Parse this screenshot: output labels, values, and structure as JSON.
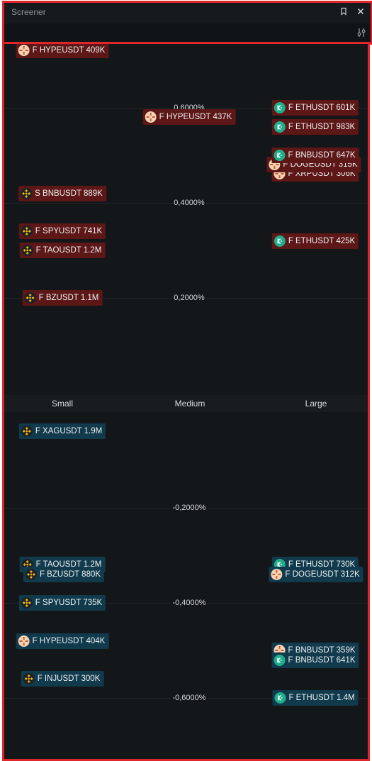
{
  "window": {
    "title": "Screener"
  },
  "axis": {
    "upper_labels": [
      "0,6000%",
      "0,4000%",
      "0,2000%"
    ],
    "lower_labels": [
      "-0,2000%",
      "-0,4000%",
      "-0,6000%"
    ]
  },
  "categories": [
    "Small",
    "Medium",
    "Large"
  ],
  "colors": {
    "positive": "#5c1716",
    "negative": "#113a4c",
    "frame": "#e0262a"
  },
  "tickers_positive": [
    {
      "label": "F HYPEUSDT 409K",
      "icon": "hyperliquid-icon"
    },
    {
      "label": "F HYPEUSDT 437K",
      "icon": "hyperliquid-icon"
    },
    {
      "label": "F ETHUSDT 601K",
      "icon": "kucoin-icon"
    },
    {
      "label": "F ETHUSDT 983K",
      "icon": "kucoin-icon"
    },
    {
      "label": "F BNBUSDT 647K",
      "icon": "kucoin-icon"
    },
    {
      "label": "F XRPUSDT 306K",
      "icon": "hyperliquid-icon"
    },
    {
      "label": "F DOGEUSDT 315K",
      "icon": "hyperliquid-icon"
    },
    {
      "label": "S BNBUSDT 889K",
      "icon": "binance-icon"
    },
    {
      "label": "F SPYUSDT 741K",
      "icon": "binance-icon"
    },
    {
      "label": "F TAOUSDT 1.2M",
      "icon": "binance-icon"
    },
    {
      "label": "F ETHUSDT 425K",
      "icon": "kucoin-icon"
    },
    {
      "label": "F BZUSDT 1.1M",
      "icon": "binance-icon"
    }
  ],
  "tickers_negative": [
    {
      "label": "F XAGUSDT 1.9M",
      "icon": "binance-icon"
    },
    {
      "label": "F TAOUSDT 1.2M",
      "icon": "binance-icon"
    },
    {
      "label": "F ETHUSDT 730K",
      "icon": "kucoin-icon"
    },
    {
      "label": "F BZUSDT 880K",
      "icon": "binance-icon"
    },
    {
      "label": "F DOGEUSDT 312K",
      "icon": "hyperliquid-icon"
    },
    {
      "label": "F SPYUSDT 735K",
      "icon": "binance-icon"
    },
    {
      "label": "F HYPEUSDT 404K",
      "icon": "hyperliquid-icon"
    },
    {
      "label": "F BNBUSDT 359K",
      "icon": "hyperliquid-icon"
    },
    {
      "label": "F BNBUSDT 641K",
      "icon": "kucoin-icon"
    },
    {
      "label": "F INJUSDT 300K",
      "icon": "binance-icon"
    },
    {
      "label": "F ETHUSDT 1.4M",
      "icon": "kucoin-icon"
    }
  ]
}
